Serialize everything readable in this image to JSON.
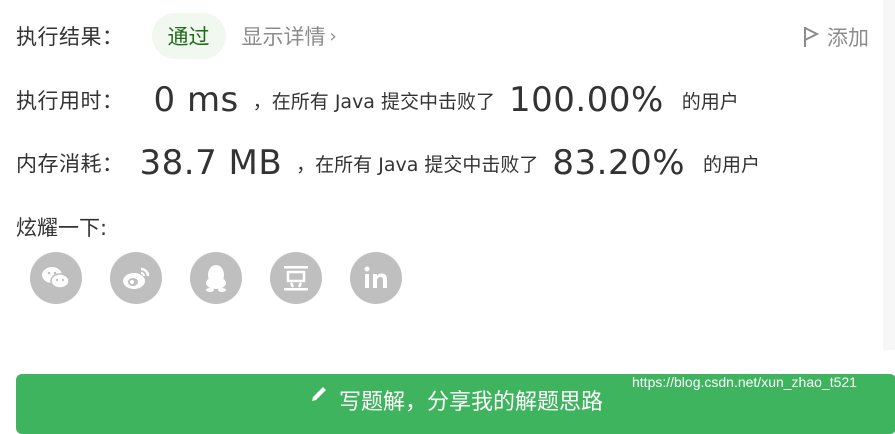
{
  "result": {
    "label": "执行结果：",
    "status": "通过",
    "details_link": "显示详情",
    "add_note": "添加"
  },
  "runtime": {
    "label": "执行用时：",
    "value": "0 ms",
    "prefix": "，在所有 Java 提交中击败了",
    "percent": "100.00%",
    "suffix": "的用户"
  },
  "memory": {
    "label": "内存消耗：",
    "value": "38.7 MB",
    "prefix": "，在所有 Java 提交中击败了",
    "percent": "83.20%",
    "suffix": "的用户"
  },
  "share": {
    "label": "炫耀一下:",
    "icons": [
      "wechat-icon",
      "weibo-icon",
      "qq-icon",
      "douban-icon",
      "linkedin-icon"
    ]
  },
  "write_solution": {
    "label": "写题解，分享我的解题思路"
  },
  "watermark": "https://blog.csdn.net/xun_zhao_t521",
  "colors": {
    "accent_green": "#3fb45e",
    "pill_bg": "#f1f8ef",
    "icon_gray": "#bfbfbf"
  }
}
